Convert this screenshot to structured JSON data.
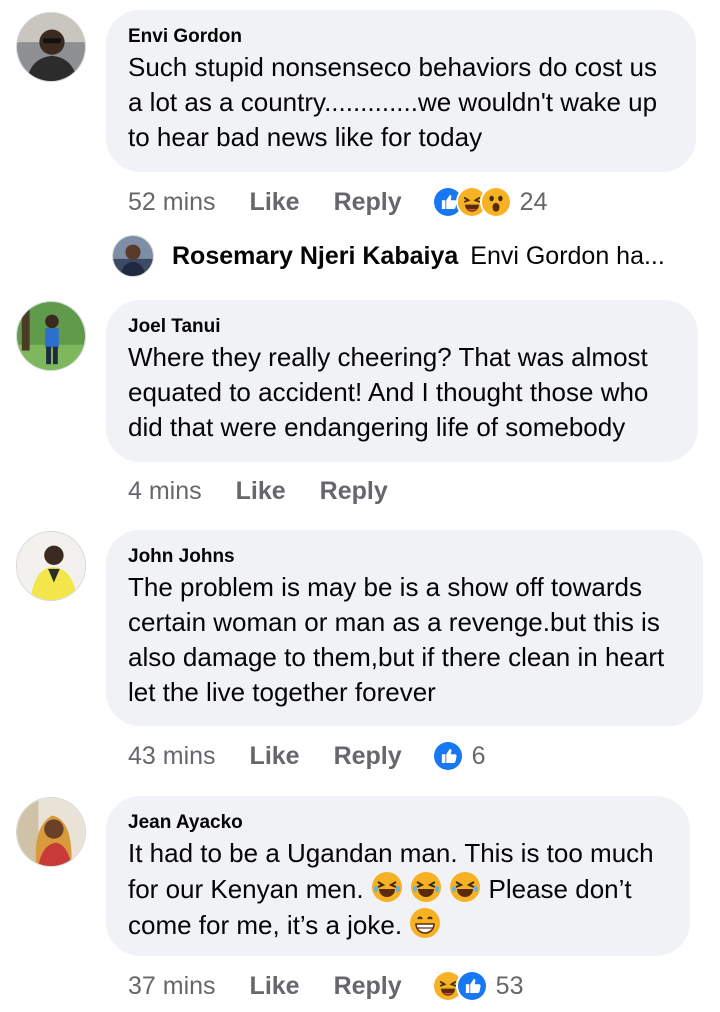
{
  "comments": [
    {
      "author": "Envi Gordon",
      "lines": [
        "Such stupid nonsenseco behaviors do cost us",
        "a lot as a country.............we wouldn't wake up",
        "to hear bad news like for today"
      ],
      "time": "52 mins",
      "like_label": "Like",
      "reply_label": "Reply",
      "reactions": [
        "like-icon",
        "laugh-icon",
        "wow-icon"
      ],
      "reaction_count": "24"
    },
    {
      "author": "Joel Tanui",
      "lines": [
        "Where they really cheering? That was almost",
        "equated to accident! And  I thought those who",
        "did that were endangering life of somebody"
      ],
      "time": "4 mins",
      "like_label": "Like",
      "reply_label": "Reply"
    },
    {
      "author": "John Johns",
      "lines": [
        "The problem is may be is a show off towards",
        "certain woman or man as a revenge.but this is",
        "also damage to them,but if there clean in heart",
        "let the live together forever"
      ],
      "time": "43 mins",
      "like_label": "Like",
      "reply_label": "Reply",
      "reactions": [
        "like-icon"
      ],
      "reaction_count": "6"
    },
    {
      "author": "Jean Ayacko",
      "line1": "It had to be a Ugandan man. This is too much",
      "line2_a": "for our Kenyan men.",
      "line2_b": "Please don’t",
      "line3": "come for me, it’s a joke.",
      "time": "37 mins",
      "like_label": "Like",
      "reply_label": "Reply",
      "reactions": [
        "laugh-icon",
        "like-icon"
      ],
      "reaction_count": "53"
    }
  ],
  "reply_preview": {
    "author": "Rosemary Njeri Kabaiya",
    "text": "Envi Gordon ha..."
  },
  "colors": {
    "bubble": "#f0f2f5",
    "meta": "#65676b",
    "like_blue": "#1877f2",
    "emoji_yellow": "#f7b125"
  }
}
